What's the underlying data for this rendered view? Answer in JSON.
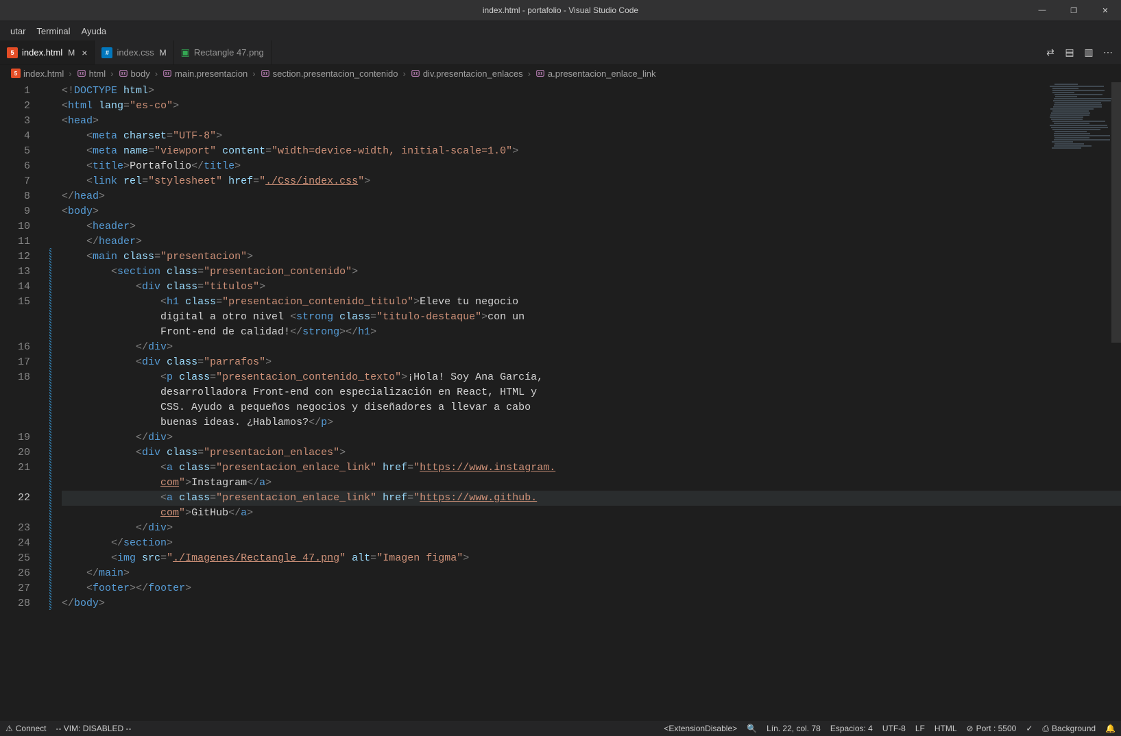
{
  "titlebar": {
    "title": "index.html - portafolio - Visual Studio Code"
  },
  "window_controls": {
    "minimize": "—",
    "maximize": "❐",
    "close": "✕"
  },
  "menu": [
    "utar",
    "Terminal",
    "Ayuda"
  ],
  "tabs": [
    {
      "icon": "html",
      "label": "index.html",
      "dirty": "M",
      "close": true,
      "active": true
    },
    {
      "icon": "css",
      "label": "index.css",
      "dirty": "M",
      "close": false,
      "active": false
    },
    {
      "icon": "img",
      "label": "Rectangle 47.png",
      "dirty": "",
      "close": false,
      "active": false
    }
  ],
  "tab_actions": {
    "compare": "⇄",
    "split_down": "▤",
    "split_right": "▥",
    "more": "⋯"
  },
  "breadcrumbs": [
    {
      "icon": "html",
      "text": "index.html"
    },
    {
      "icon": "sym",
      "text": "html"
    },
    {
      "icon": "sym",
      "text": "body"
    },
    {
      "icon": "sym",
      "text": "main.presentacion"
    },
    {
      "icon": "sym",
      "text": "section.presentacion_contenido"
    },
    {
      "icon": "sym",
      "text": "div.presentacion_enlaces"
    },
    {
      "icon": "sym",
      "text": "a.presentacion_enlace_link"
    }
  ],
  "line_numbers": [
    "1",
    "2",
    "3",
    "4",
    "5",
    "6",
    "7",
    "8",
    "9",
    "10",
    "11",
    "12",
    "13",
    "14",
    "15",
    "",
    "",
    "16",
    "17",
    "18",
    "",
    "",
    "",
    "19",
    "20",
    "21",
    "",
    "22",
    "",
    "23",
    "24",
    "25",
    "26",
    "27",
    "28"
  ],
  "current_line": 22,
  "code_lines": [
    [
      {
        "c": "t-punc",
        "t": "<!"
      },
      {
        "c": "t-doctype",
        "t": "DOCTYPE "
      },
      {
        "c": "t-attr",
        "t": "html"
      },
      {
        "c": "t-punc",
        "t": ">"
      }
    ],
    [
      {
        "c": "t-punc",
        "t": "<"
      },
      {
        "c": "t-tag",
        "t": "html"
      },
      {
        "c": "t-attr",
        "t": " lang"
      },
      {
        "c": "t-punc",
        "t": "="
      },
      {
        "c": "t-str",
        "t": "\"es-co\""
      },
      {
        "c": "t-punc",
        "t": ">"
      }
    ],
    [
      {
        "c": "t-punc",
        "t": "<"
      },
      {
        "c": "t-tag",
        "t": "head"
      },
      {
        "c": "t-punc",
        "t": ">"
      }
    ],
    [
      {
        "c": "",
        "t": "    "
      },
      {
        "c": "t-punc",
        "t": "<"
      },
      {
        "c": "t-tag",
        "t": "meta"
      },
      {
        "c": "t-attr",
        "t": " charset"
      },
      {
        "c": "t-punc",
        "t": "="
      },
      {
        "c": "t-str",
        "t": "\"UTF-8\""
      },
      {
        "c": "t-punc",
        "t": ">"
      }
    ],
    [
      {
        "c": "",
        "t": "    "
      },
      {
        "c": "t-punc",
        "t": "<"
      },
      {
        "c": "t-tag",
        "t": "meta"
      },
      {
        "c": "t-attr",
        "t": " name"
      },
      {
        "c": "t-punc",
        "t": "="
      },
      {
        "c": "t-str",
        "t": "\"viewport\""
      },
      {
        "c": "t-attr",
        "t": " content"
      },
      {
        "c": "t-punc",
        "t": "="
      },
      {
        "c": "t-str",
        "t": "\"width=device-width, initial-scale=1.0\""
      },
      {
        "c": "t-punc",
        "t": ">"
      }
    ],
    [
      {
        "c": "",
        "t": "    "
      },
      {
        "c": "t-punc",
        "t": "<"
      },
      {
        "c": "t-tag",
        "t": "title"
      },
      {
        "c": "t-punc",
        "t": ">"
      },
      {
        "c": "t-text",
        "t": "Portafolio"
      },
      {
        "c": "t-punc",
        "t": "</"
      },
      {
        "c": "t-tag",
        "t": "title"
      },
      {
        "c": "t-punc",
        "t": ">"
      }
    ],
    [
      {
        "c": "",
        "t": "    "
      },
      {
        "c": "t-punc",
        "t": "<"
      },
      {
        "c": "t-tag",
        "t": "link"
      },
      {
        "c": "t-attr",
        "t": " rel"
      },
      {
        "c": "t-punc",
        "t": "="
      },
      {
        "c": "t-str",
        "t": "\"stylesheet\""
      },
      {
        "c": "t-attr",
        "t": " href"
      },
      {
        "c": "t-punc",
        "t": "="
      },
      {
        "c": "t-str",
        "t": "\""
      },
      {
        "c": "t-url",
        "t": "./Css/index.css"
      },
      {
        "c": "t-str",
        "t": "\""
      },
      {
        "c": "t-punc",
        "t": ">"
      }
    ],
    [
      {
        "c": "t-punc",
        "t": "</"
      },
      {
        "c": "t-tag",
        "t": "head"
      },
      {
        "c": "t-punc",
        "t": ">"
      }
    ],
    [
      {
        "c": "t-punc",
        "t": "<"
      },
      {
        "c": "t-tag",
        "t": "body"
      },
      {
        "c": "t-punc",
        "t": ">"
      }
    ],
    [
      {
        "c": "",
        "t": "    "
      },
      {
        "c": "t-punc",
        "t": "<"
      },
      {
        "c": "t-tag",
        "t": "header"
      },
      {
        "c": "t-punc",
        "t": ">"
      }
    ],
    [
      {
        "c": "",
        "t": "    "
      },
      {
        "c": "t-punc",
        "t": "</"
      },
      {
        "c": "t-tag",
        "t": "header"
      },
      {
        "c": "t-punc",
        "t": ">"
      }
    ],
    [
      {
        "c": "",
        "t": "    "
      },
      {
        "c": "t-punc",
        "t": "<"
      },
      {
        "c": "t-tag",
        "t": "main"
      },
      {
        "c": "t-attr",
        "t": " class"
      },
      {
        "c": "t-punc",
        "t": "="
      },
      {
        "c": "t-str",
        "t": "\"presentacion\""
      },
      {
        "c": "t-punc",
        "t": ">"
      }
    ],
    [
      {
        "c": "",
        "t": "        "
      },
      {
        "c": "t-punc",
        "t": "<"
      },
      {
        "c": "t-tag",
        "t": "section"
      },
      {
        "c": "t-attr",
        "t": " class"
      },
      {
        "c": "t-punc",
        "t": "="
      },
      {
        "c": "t-str",
        "t": "\"presentacion_contenido\""
      },
      {
        "c": "t-punc",
        "t": ">"
      }
    ],
    [
      {
        "c": "",
        "t": "            "
      },
      {
        "c": "t-punc",
        "t": "<"
      },
      {
        "c": "t-tag",
        "t": "div"
      },
      {
        "c": "t-attr",
        "t": " class"
      },
      {
        "c": "t-punc",
        "t": "="
      },
      {
        "c": "t-str",
        "t": "\"titulos\""
      },
      {
        "c": "t-punc",
        "t": ">"
      }
    ],
    [
      {
        "c": "",
        "t": "                "
      },
      {
        "c": "t-punc",
        "t": "<"
      },
      {
        "c": "t-tag",
        "t": "h1"
      },
      {
        "c": "t-attr",
        "t": " class"
      },
      {
        "c": "t-punc",
        "t": "="
      },
      {
        "c": "t-str",
        "t": "\"presentacion_contenido_titulo\""
      },
      {
        "c": "t-punc",
        "t": ">"
      },
      {
        "c": "t-text",
        "t": "Eleve tu negocio "
      }
    ],
    [
      {
        "c": "",
        "t": "                "
      },
      {
        "c": "t-text",
        "t": "digital a otro nivel "
      },
      {
        "c": "t-punc",
        "t": "<"
      },
      {
        "c": "t-tag",
        "t": "strong"
      },
      {
        "c": "t-attr",
        "t": " class"
      },
      {
        "c": "t-punc",
        "t": "="
      },
      {
        "c": "t-str",
        "t": "\"titulo-destaque\""
      },
      {
        "c": "t-punc",
        "t": ">"
      },
      {
        "c": "t-text",
        "t": "con un "
      }
    ],
    [
      {
        "c": "",
        "t": "                "
      },
      {
        "c": "t-text",
        "t": "Front-end de calidad!"
      },
      {
        "c": "t-punc",
        "t": "</"
      },
      {
        "c": "t-tag",
        "t": "strong"
      },
      {
        "c": "t-punc",
        "t": ">"
      },
      {
        "c": "t-punc",
        "t": "</"
      },
      {
        "c": "t-tag",
        "t": "h1"
      },
      {
        "c": "t-punc",
        "t": ">"
      }
    ],
    [
      {
        "c": "",
        "t": "            "
      },
      {
        "c": "t-punc",
        "t": "</"
      },
      {
        "c": "t-tag",
        "t": "div"
      },
      {
        "c": "t-punc",
        "t": ">"
      }
    ],
    [
      {
        "c": "",
        "t": "            "
      },
      {
        "c": "t-punc",
        "t": "<"
      },
      {
        "c": "t-tag",
        "t": "div"
      },
      {
        "c": "t-attr",
        "t": " class"
      },
      {
        "c": "t-punc",
        "t": "="
      },
      {
        "c": "t-str",
        "t": "\"parrafos\""
      },
      {
        "c": "t-punc",
        "t": ">"
      }
    ],
    [
      {
        "c": "",
        "t": "                "
      },
      {
        "c": "t-punc",
        "t": "<"
      },
      {
        "c": "t-tag",
        "t": "p"
      },
      {
        "c": "t-attr",
        "t": " class"
      },
      {
        "c": "t-punc",
        "t": "="
      },
      {
        "c": "t-str",
        "t": "\"presentacion_contenido_texto\""
      },
      {
        "c": "t-punc",
        "t": ">"
      },
      {
        "c": "t-text",
        "t": "¡Hola! Soy Ana García, "
      }
    ],
    [
      {
        "c": "",
        "t": "                "
      },
      {
        "c": "t-text",
        "t": "desarrolladora Front-end con especialización en React, HTML y "
      }
    ],
    [
      {
        "c": "",
        "t": "                "
      },
      {
        "c": "t-text",
        "t": "CSS. Ayudo a pequeños negocios y diseñadores a llevar a cabo "
      }
    ],
    [
      {
        "c": "",
        "t": "                "
      },
      {
        "c": "t-text",
        "t": "buenas ideas. ¿Hablamos?"
      },
      {
        "c": "t-punc",
        "t": "</"
      },
      {
        "c": "t-tag",
        "t": "p"
      },
      {
        "c": "t-punc",
        "t": ">"
      }
    ],
    [
      {
        "c": "",
        "t": "            "
      },
      {
        "c": "t-punc",
        "t": "</"
      },
      {
        "c": "t-tag",
        "t": "div"
      },
      {
        "c": "t-punc",
        "t": ">"
      }
    ],
    [
      {
        "c": "",
        "t": "            "
      },
      {
        "c": "t-punc",
        "t": "<"
      },
      {
        "c": "t-tag",
        "t": "div"
      },
      {
        "c": "t-attr",
        "t": " class"
      },
      {
        "c": "t-punc",
        "t": "="
      },
      {
        "c": "t-str",
        "t": "\"presentacion_enlaces\""
      },
      {
        "c": "t-punc",
        "t": ">"
      }
    ],
    [
      {
        "c": "",
        "t": "                "
      },
      {
        "c": "t-punc",
        "t": "<"
      },
      {
        "c": "t-tag",
        "t": "a"
      },
      {
        "c": "t-attr",
        "t": " class"
      },
      {
        "c": "t-punc",
        "t": "="
      },
      {
        "c": "t-str",
        "t": "\"presentacion_enlace_link\""
      },
      {
        "c": "t-attr",
        "t": " href"
      },
      {
        "c": "t-punc",
        "t": "="
      },
      {
        "c": "t-str",
        "t": "\""
      },
      {
        "c": "t-url",
        "t": "https://www.instagram."
      }
    ],
    [
      {
        "c": "",
        "t": "                "
      },
      {
        "c": "t-url",
        "t": "com"
      },
      {
        "c": "t-str",
        "t": "\""
      },
      {
        "c": "t-punc",
        "t": ">"
      },
      {
        "c": "t-text",
        "t": "Instagram"
      },
      {
        "c": "t-punc",
        "t": "</"
      },
      {
        "c": "t-tag",
        "t": "a"
      },
      {
        "c": "t-punc",
        "t": ">"
      }
    ],
    [
      {
        "c": "",
        "t": "                "
      },
      {
        "c": "t-punc",
        "t": "<"
      },
      {
        "c": "t-tag",
        "t": "a"
      },
      {
        "c": "t-attr",
        "t": " class"
      },
      {
        "c": "t-punc",
        "t": "="
      },
      {
        "c": "t-str",
        "t": "\"presentacion_enlace_link\""
      },
      {
        "c": "t-attr",
        "t": " href"
      },
      {
        "c": "t-punc",
        "t": "="
      },
      {
        "c": "t-str",
        "t": "\""
      },
      {
        "c": "t-url",
        "t": "https://www.github."
      }
    ],
    [
      {
        "c": "",
        "t": "                "
      },
      {
        "c": "t-url",
        "t": "com"
      },
      {
        "c": "t-str",
        "t": "\""
      },
      {
        "c": "t-punc",
        "t": ">"
      },
      {
        "c": "t-text",
        "t": "GitHub"
      },
      {
        "c": "t-punc",
        "t": "</"
      },
      {
        "c": "t-tag",
        "t": "a"
      },
      {
        "c": "t-punc",
        "t": ">"
      }
    ],
    [
      {
        "c": "",
        "t": "            "
      },
      {
        "c": "t-punc",
        "t": "</"
      },
      {
        "c": "t-tag",
        "t": "div"
      },
      {
        "c": "t-punc",
        "t": ">"
      }
    ],
    [
      {
        "c": "",
        "t": "        "
      },
      {
        "c": "t-punc",
        "t": "</"
      },
      {
        "c": "t-tag",
        "t": "section"
      },
      {
        "c": "t-punc",
        "t": ">"
      }
    ],
    [
      {
        "c": "",
        "t": "        "
      },
      {
        "c": "t-punc",
        "t": "<"
      },
      {
        "c": "t-tag",
        "t": "img"
      },
      {
        "c": "t-attr",
        "t": " src"
      },
      {
        "c": "t-punc",
        "t": "="
      },
      {
        "c": "t-str",
        "t": "\""
      },
      {
        "c": "t-url",
        "t": "./Imagenes/Rectangle 47.png"
      },
      {
        "c": "t-str",
        "t": "\""
      },
      {
        "c": "t-attr",
        "t": " alt"
      },
      {
        "c": "t-punc",
        "t": "="
      },
      {
        "c": "t-str",
        "t": "\"Imagen figma\""
      },
      {
        "c": "t-punc",
        "t": ">"
      }
    ],
    [
      {
        "c": "",
        "t": "    "
      },
      {
        "c": "t-punc",
        "t": "</"
      },
      {
        "c": "t-tag",
        "t": "main"
      },
      {
        "c": "t-punc",
        "t": ">"
      }
    ],
    [
      {
        "c": "",
        "t": "    "
      },
      {
        "c": "t-punc",
        "t": "<"
      },
      {
        "c": "t-tag",
        "t": "footer"
      },
      {
        "c": "t-punc",
        "t": ">"
      },
      {
        "c": "t-punc",
        "t": "</"
      },
      {
        "c": "t-tag",
        "t": "footer"
      },
      {
        "c": "t-punc",
        "t": ">"
      }
    ],
    [
      {
        "c": "t-punc",
        "t": "</"
      },
      {
        "c": "t-tag",
        "t": "body"
      },
      {
        "c": "t-punc",
        "t": ">"
      }
    ]
  ],
  "statusbar": {
    "left": [
      {
        "icon": "⚠",
        "text": "Connect"
      },
      {
        "icon": "",
        "text": "-- VIM: DISABLED --"
      }
    ],
    "right": [
      {
        "icon": "",
        "text": "<ExtensionDisable>"
      },
      {
        "icon": "🔍",
        "text": ""
      },
      {
        "icon": "",
        "text": "Lín. 22, col. 78"
      },
      {
        "icon": "",
        "text": "Espacios: 4"
      },
      {
        "icon": "",
        "text": "UTF-8"
      },
      {
        "icon": "",
        "text": "LF"
      },
      {
        "icon": "",
        "text": "HTML"
      },
      {
        "icon": "⊘",
        "text": "Port : 5500"
      },
      {
        "icon": "✓",
        "text": ""
      },
      {
        "icon": "⎙",
        "text": "Background"
      },
      {
        "icon": "🔔",
        "text": ""
      }
    ]
  }
}
